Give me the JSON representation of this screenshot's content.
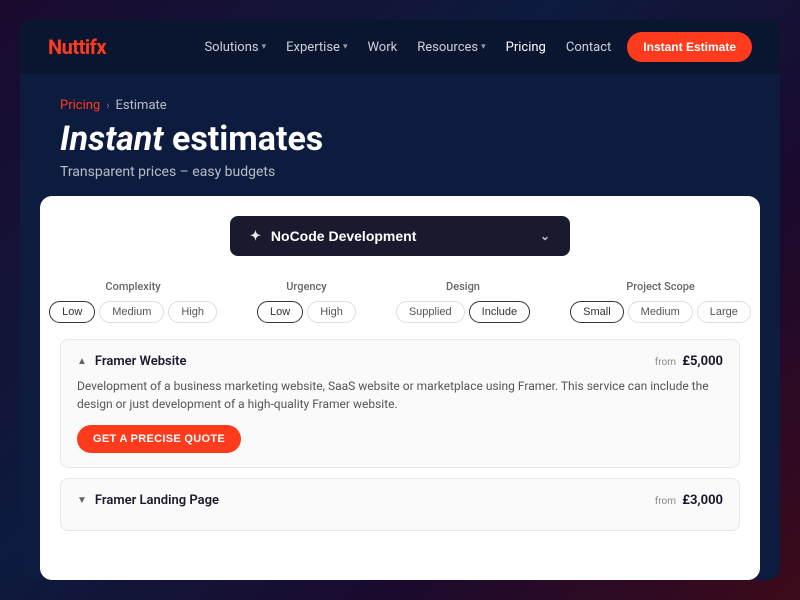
{
  "window": {
    "background": "#0d1b3e"
  },
  "nav": {
    "logo_text": "Nuttif",
    "logo_highlight": "x",
    "links": [
      {
        "label": "Solutions",
        "has_dropdown": true
      },
      {
        "label": "Expertise",
        "has_dropdown": true
      },
      {
        "label": "Work",
        "has_dropdown": false
      },
      {
        "label": "Resources",
        "has_dropdown": true
      },
      {
        "label": "Pricing",
        "has_dropdown": false
      },
      {
        "label": "Contact",
        "has_dropdown": false
      }
    ],
    "cta_label": "Instant Estimate"
  },
  "hero": {
    "breadcrumb_pricing": "Pricing",
    "breadcrumb_sep": "›",
    "breadcrumb_current": "Estimate",
    "title_italic": "Instant",
    "title_rest": " estimates",
    "subtitle": "Transparent prices – easy budgets"
  },
  "card": {
    "dropdown": {
      "icon": "✦",
      "label": "NoCode Development",
      "chevron": "⌄"
    },
    "filters": [
      {
        "label": "Complexity",
        "options": [
          {
            "label": "Low",
            "active": true
          },
          {
            "label": "Medium",
            "active": false
          },
          {
            "label": "High",
            "active": false
          }
        ]
      },
      {
        "label": "Urgency",
        "options": [
          {
            "label": "Low",
            "active": true
          },
          {
            "label": "High",
            "active": false
          }
        ]
      },
      {
        "label": "Design",
        "options": [
          {
            "label": "Supplied",
            "active": false
          },
          {
            "label": "Include",
            "active": true
          }
        ]
      },
      {
        "label": "Project Scope",
        "options": [
          {
            "label": "Small",
            "active": true
          },
          {
            "label": "Medium",
            "active": false
          },
          {
            "label": "Large",
            "active": false
          }
        ]
      }
    ],
    "services": [
      {
        "title": "Framer Website",
        "price_from": "from",
        "price": "£5,000",
        "expanded": true,
        "description": "Development of a business marketing website, SaaS website or marketplace using Framer. This service can include the design or just development of a high-quality Framer website.",
        "cta_label": "GET A PRECISE QUOTE"
      },
      {
        "title": "Framer Landing Page",
        "price_from": "from",
        "price": "£3,000",
        "expanded": false,
        "description": "",
        "cta_label": ""
      }
    ]
  }
}
